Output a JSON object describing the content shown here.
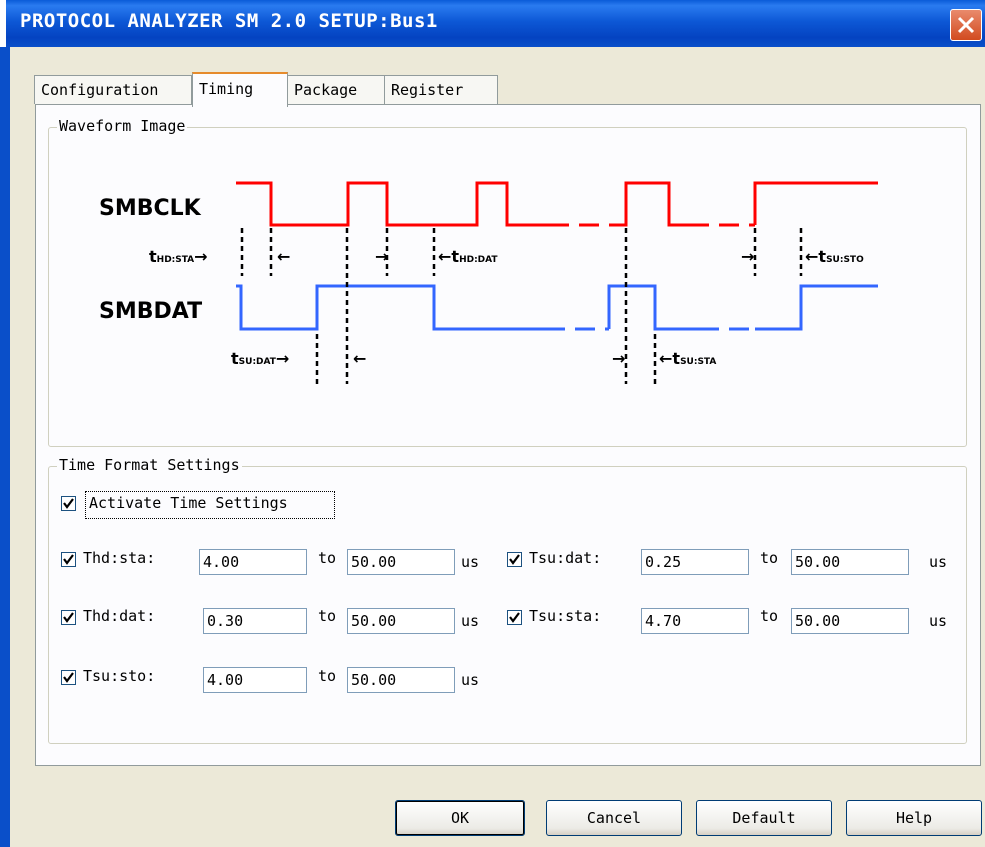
{
  "window": {
    "title": "PROTOCOL ANALYZER SM 2.0 SETUP:Bus1"
  },
  "tabs": [
    {
      "label": "Configuration",
      "active": false
    },
    {
      "label": "Timing",
      "active": true
    },
    {
      "label": "Package",
      "active": false
    },
    {
      "label": "Register",
      "active": false
    }
  ],
  "waveform": {
    "legend": "Waveform Image",
    "clk_label": "SMBCLK",
    "dat_label": "SMBDAT",
    "annotations": {
      "hd_sta": "HD:STA",
      "hd_dat": "HD:DAT",
      "su_sto": "SU:STO",
      "su_dat": "SU:DAT",
      "su_sta": "SU:STA",
      "t": "t"
    },
    "colors": {
      "clk": "#ff0000",
      "dat": "#3366ff"
    }
  },
  "time_settings": {
    "legend": "Time Format Settings",
    "activate": {
      "label": "Activate Time Settings",
      "checked": true
    },
    "rows": [
      {
        "label": "Thd:sta:",
        "checked": true,
        "min": "4.00",
        "to": "to",
        "max": "50.00",
        "unit": "us"
      },
      {
        "label": "Tsu:dat:",
        "checked": true,
        "min": "0.25",
        "to": "to",
        "max": "50.00",
        "unit": "us"
      },
      {
        "label": "Thd:dat:",
        "checked": true,
        "min": "0.30",
        "to": "to",
        "max": "50.00",
        "unit": "us"
      },
      {
        "label": "Tsu:sta:",
        "checked": true,
        "min": "4.70",
        "to": "to",
        "max": "50.00",
        "unit": "us"
      },
      {
        "label": "Tsu:sto:",
        "checked": true,
        "min": "4.00",
        "to": "to",
        "max": "50.00",
        "unit": "us"
      }
    ]
  },
  "buttons": {
    "ok": "OK",
    "cancel": "Cancel",
    "default": "Default",
    "help": "Help"
  }
}
